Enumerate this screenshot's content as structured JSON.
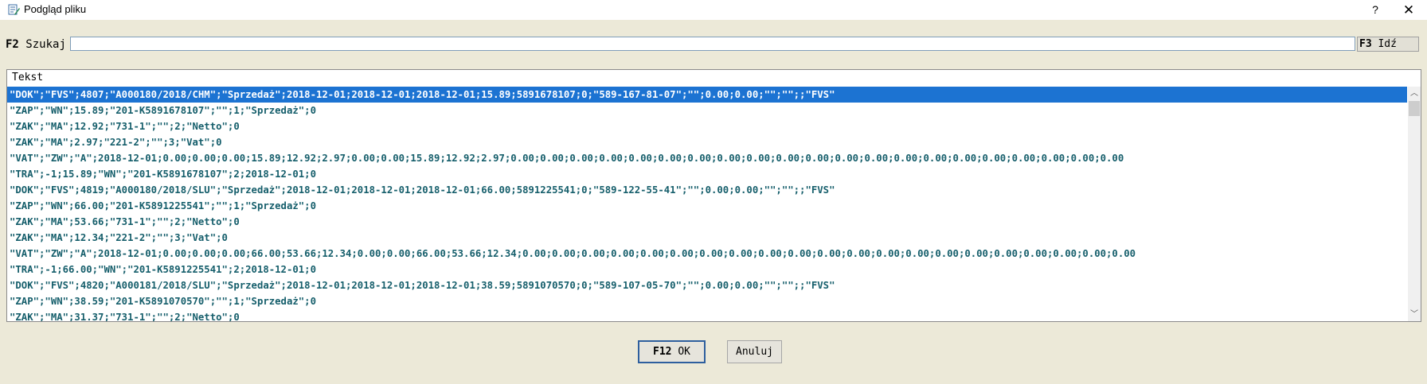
{
  "window": {
    "title": "Podgląd pliku",
    "help_label": "?",
    "close_label": "✕",
    "icon": "document-edit-icon"
  },
  "search": {
    "key": "F2",
    "label": "Szukaj",
    "value": "",
    "placeholder": "",
    "goto_key": "F3",
    "goto_label": "Idź"
  },
  "list": {
    "column_header": "Tekst",
    "selected_index": 0,
    "rows": [
      "\"DOK\";\"FVS\";4807;\"A000180/2018/CHM\";\"Sprzedaż\";2018-12-01;2018-12-01;2018-12-01;15.89;5891678107;0;\"589-167-81-07\";\"\";0.00;0.00;\"\";\"\";;\"FVS\"",
      "\"ZAP\";\"WN\";15.89;\"201-K5891678107\";\"\";1;\"Sprzedaż\";0",
      "\"ZAK\";\"MA\";12.92;\"731-1\";\"\";2;\"Netto\";0",
      "\"ZAK\";\"MA\";2.97;\"221-2\";\"\";3;\"Vat\";0",
      "\"VAT\";\"ZW\";\"A\";2018-12-01;0.00;0.00;0.00;15.89;12.92;2.97;0.00;0.00;15.89;12.92;2.97;0.00;0.00;0.00;0.00;0.00;0.00;0.00;0.00;0.00;0.00;0.00;0.00;0.00;0.00;0.00;0.00;0.00;0.00;0.00;0.00;0.00",
      "\"TRA\";-1;15.89;\"WN\";\"201-K5891678107\";2;2018-12-01;0",
      "\"DOK\";\"FVS\";4819;\"A000180/2018/SLU\";\"Sprzedaż\";2018-12-01;2018-12-01;2018-12-01;66.00;5891225541;0;\"589-122-55-41\";\"\";0.00;0.00;\"\";\"\";;\"FVS\"",
      "\"ZAP\";\"WN\";66.00;\"201-K5891225541\";\"\";1;\"Sprzedaż\";0",
      "\"ZAK\";\"MA\";53.66;\"731-1\";\"\";2;\"Netto\";0",
      "\"ZAK\";\"MA\";12.34;\"221-2\";\"\";3;\"Vat\";0",
      "\"VAT\";\"ZW\";\"A\";2018-12-01;0.00;0.00;0.00;66.00;53.66;12.34;0.00;0.00;66.00;53.66;12.34;0.00;0.00;0.00;0.00;0.00;0.00;0.00;0.00;0.00;0.00;0.00;0.00;0.00;0.00;0.00;0.00;0.00;0.00;0.00;0.00;0.00",
      "\"TRA\";-1;66.00;\"WN\";\"201-K5891225541\";2;2018-12-01;0",
      "\"DOK\";\"FVS\";4820;\"A000181/2018/SLU\";\"Sprzedaż\";2018-12-01;2018-12-01;2018-12-01;38.59;5891070570;0;\"589-107-05-70\";\"\";0.00;0.00;\"\";\"\";;\"FVS\"",
      "\"ZAP\";\"WN\";38.59;\"201-K5891070570\";\"\";1;\"Sprzedaż\";0",
      "\"ZAK\";\"MA\";31.37;\"731-1\";\"\";2;\"Netto\";0"
    ]
  },
  "buttons": {
    "ok_key": "F12",
    "ok_label": "OK",
    "cancel_label": "Anuluj"
  },
  "colors": {
    "dialog_bg": "#ece9d8",
    "row_text": "#155e6b",
    "selection_bg": "#1c73d2"
  }
}
